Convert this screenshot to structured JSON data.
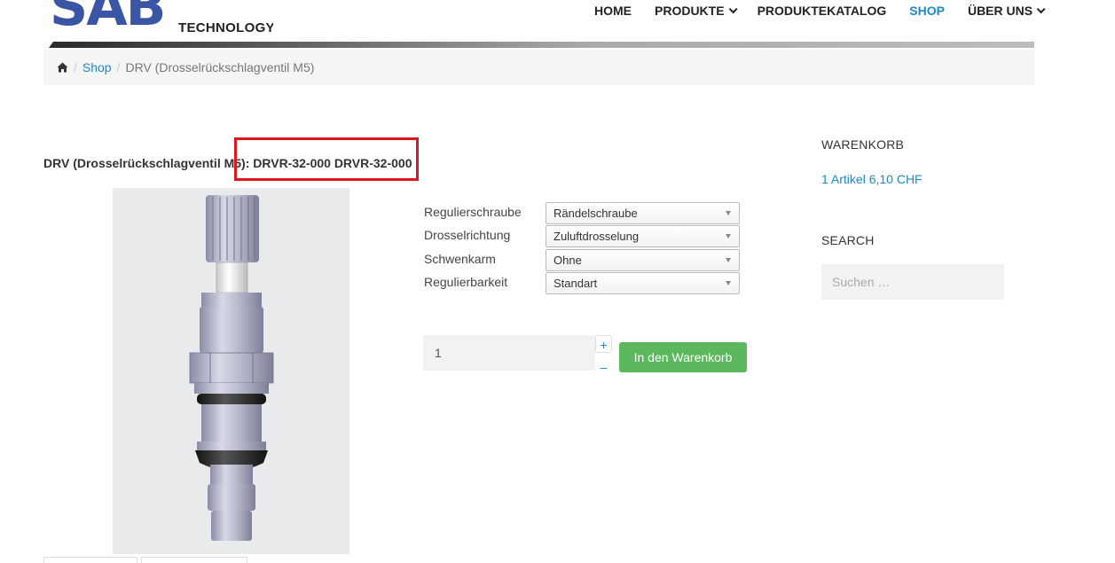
{
  "logo": {
    "primary": "SAB",
    "secondary": "TECHNOLOGY"
  },
  "nav": {
    "items": [
      {
        "label": "HOME",
        "has_dropdown": false,
        "active": false
      },
      {
        "label": "PRODUKTE",
        "has_dropdown": true,
        "active": false
      },
      {
        "label": "PRODUKTEKATALOG",
        "has_dropdown": false,
        "active": false
      },
      {
        "label": "SHOP",
        "has_dropdown": false,
        "active": true
      },
      {
        "label": "ÜBER UNS",
        "has_dropdown": true,
        "active": false
      }
    ]
  },
  "breadcrumb": {
    "home_icon": "home-icon",
    "shop": "Shop",
    "current": "DRV (Drosselrückschlagventil M5)",
    "separator": "/"
  },
  "product": {
    "title": "DRV (Drosselrückschlagventil M5): DRVR-32-000 DRVR-32-000",
    "variations": [
      {
        "label": "Regulierschraube",
        "selected": "Rändelschraube"
      },
      {
        "label": "Drosselrichtung",
        "selected": "Zuluftdrosselung"
      },
      {
        "label": "Schwenkarm",
        "selected": "Ohne"
      },
      {
        "label": "Regulierbarkeit",
        "selected": "Standart"
      }
    ],
    "quantity": "1",
    "qty_plus": "+",
    "qty_minus": "–",
    "add_to_cart": "In den Warenkorb"
  },
  "sidebar": {
    "cart_title": "WARENKORB",
    "cart_summary": "1 Artikel 6,10 CHF",
    "search_title": "SEARCH",
    "search_placeholder": "Suchen …"
  },
  "colors": {
    "accent": "#1e88c8",
    "button": "#5cb85c",
    "highlight": "#e0151d",
    "logo": "#3a55a3"
  }
}
